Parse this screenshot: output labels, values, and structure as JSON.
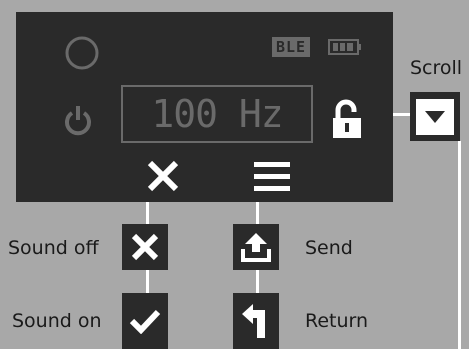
{
  "device": {
    "ble_badge": "BLE",
    "frequency": "100 Hz"
  },
  "labels": {
    "scroll": "Scroll",
    "sound_off": "Sound off",
    "sound_on": "Sound on",
    "send": "Send",
    "return": "Return"
  },
  "colors": {
    "background": "#a8a8a8",
    "screen": "#2a2a2a",
    "dim_element": "#6a6a6a",
    "bright_element": "#ffffff"
  },
  "icons": [
    "ring-icon",
    "battery-icon",
    "power-icon",
    "unlocked-padlock-icon",
    "x-icon",
    "menu-icon",
    "down-arrow-icon",
    "check-icon",
    "upload-icon",
    "return-arrow-icon"
  ]
}
